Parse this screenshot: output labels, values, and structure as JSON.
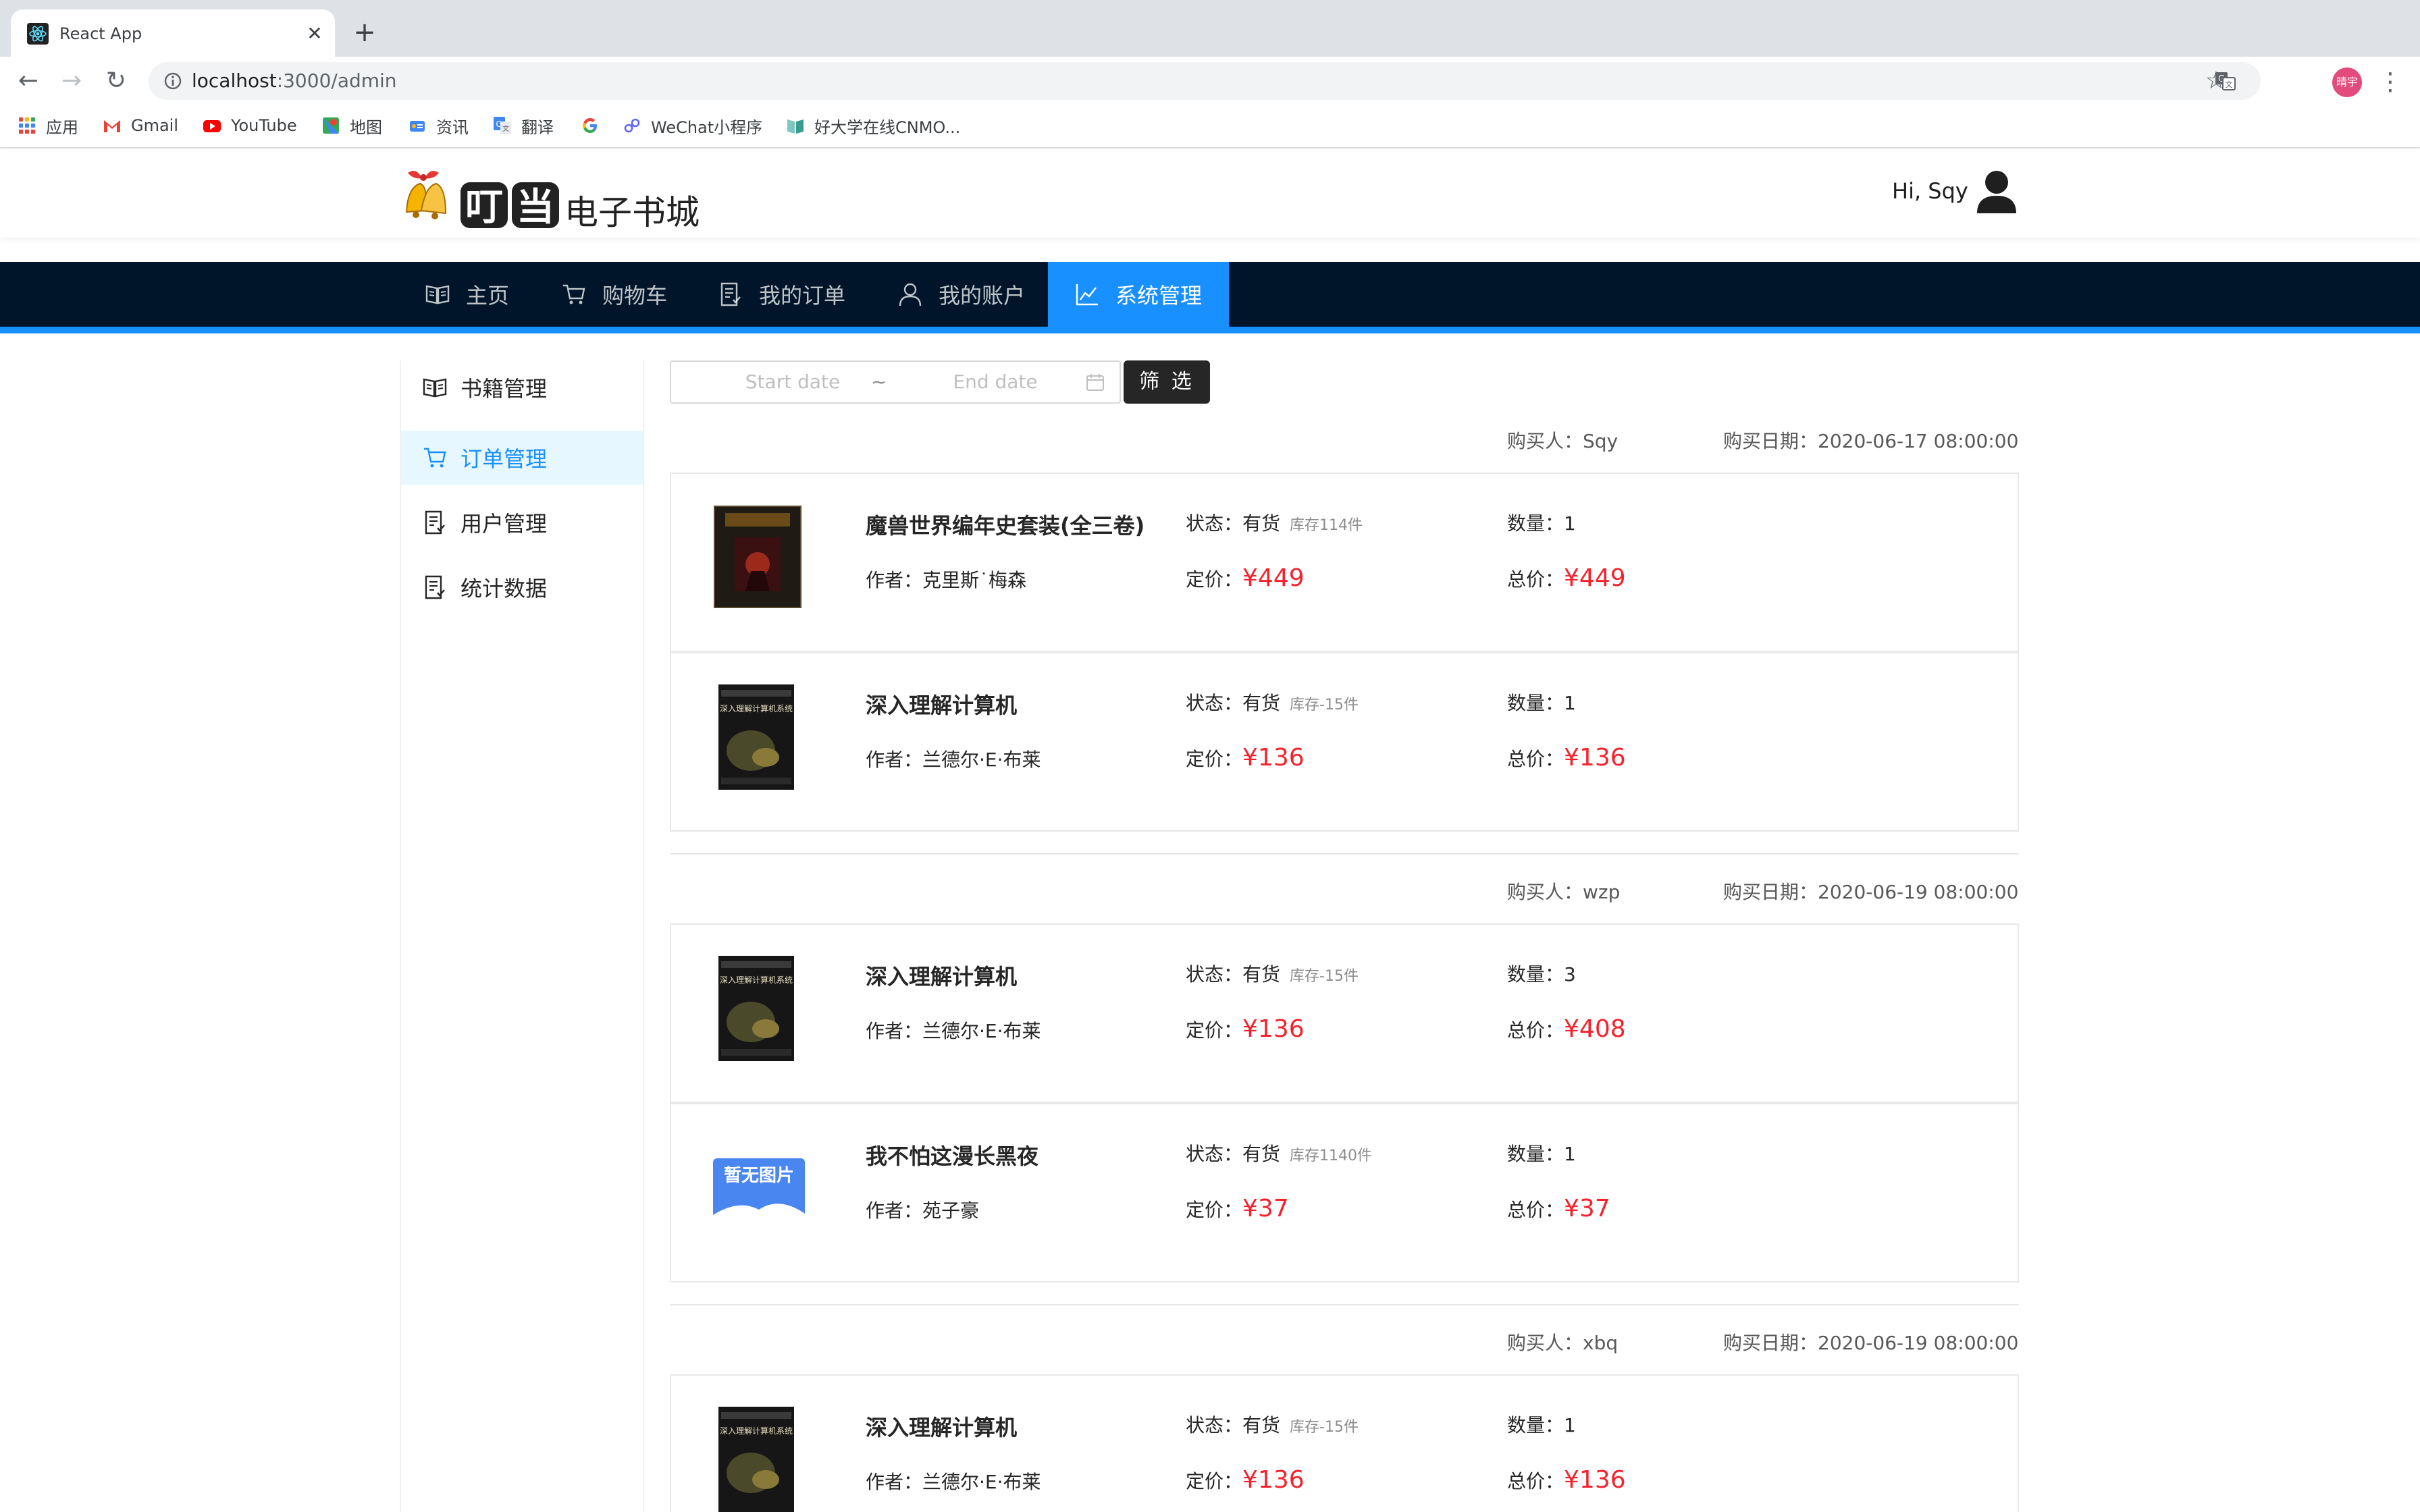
{
  "browser": {
    "tab_title": "React App",
    "tab_close": "✕",
    "new_tab": "+",
    "url_host": "localhost",
    "url_rest": ":3000/admin",
    "profile_initials": "晴宇",
    "bookmarks": [
      "应用",
      "Gmail",
      "YouTube",
      "地图",
      "资讯",
      "翻译",
      "",
      "WeChat小程序",
      "好大学在线CNMO..."
    ]
  },
  "header": {
    "greeting": "Hi, Sqy"
  },
  "nav": {
    "items": [
      "主页",
      "购物车",
      "我的订单",
      "我的账户",
      "系统管理"
    ],
    "active_index": 4
  },
  "sidebar": {
    "items": [
      "书籍管理",
      "订单管理",
      "用户管理",
      "统计数据"
    ],
    "active_index": 1
  },
  "filter": {
    "start_placeholder": "Start date",
    "separator": "~",
    "end_placeholder": "End date",
    "button_label": "筛 选"
  },
  "labels": {
    "buyer": "购买人：",
    "date": "购买日期：",
    "status": "状态：",
    "author": "作者：",
    "price": "定价：",
    "quantity": "数量：",
    "total": "总价："
  },
  "orders": [
    {
      "buyer": "Sqy",
      "date": "2020-06-17 08:00:00",
      "items": [
        {
          "title": "魔兽世界编年史套装(全三卷)",
          "author": "克里斯˙梅森",
          "status": "有货",
          "stock": "库存114件",
          "price": "¥449",
          "quantity": "1",
          "total": "¥449",
          "cover": "wow-book-cover"
        }
      ]
    },
    {
      "buyer": "",
      "date": "",
      "items": [
        {
          "title": "深入理解计算机",
          "author": "兰德尔·E·布莱",
          "status": "有货",
          "stock": "库存-15件",
          "price": "¥136",
          "quantity": "1",
          "total": "¥136",
          "cover": "csapp-book-cover"
        }
      ]
    },
    {
      "buyer": "wzp",
      "date": "2020-06-19 08:00:00",
      "items": [
        {
          "title": "深入理解计算机",
          "author": "兰德尔·E·布莱",
          "status": "有货",
          "stock": "库存-15件",
          "price": "¥136",
          "quantity": "3",
          "total": "¥408",
          "cover": "csapp-book-cover"
        },
        {
          "title": "我不怕这漫长黑夜",
          "author": "苑子豪",
          "status": "有货",
          "stock": "库存1140件",
          "price": "¥37",
          "quantity": "1",
          "total": "¥37",
          "cover": "no-image-placeholder"
        }
      ]
    },
    {
      "buyer": "xbq",
      "date": "2020-06-19 08:00:00",
      "items": [
        {
          "title": "深入理解计算机",
          "author": "兰德尔·E·布莱",
          "status": "有货",
          "stock": "库存-15件",
          "price": "¥136",
          "quantity": "1",
          "total": "¥136",
          "cover": "csapp-book-cover"
        }
      ]
    }
  ],
  "placeholder_cover_text": "暂无图片",
  "colors": {
    "nav_bg": "#001529",
    "accent": "#1890ff",
    "price_red": "#f5222d",
    "sidebar_active_bg": "#e6f7ff"
  }
}
